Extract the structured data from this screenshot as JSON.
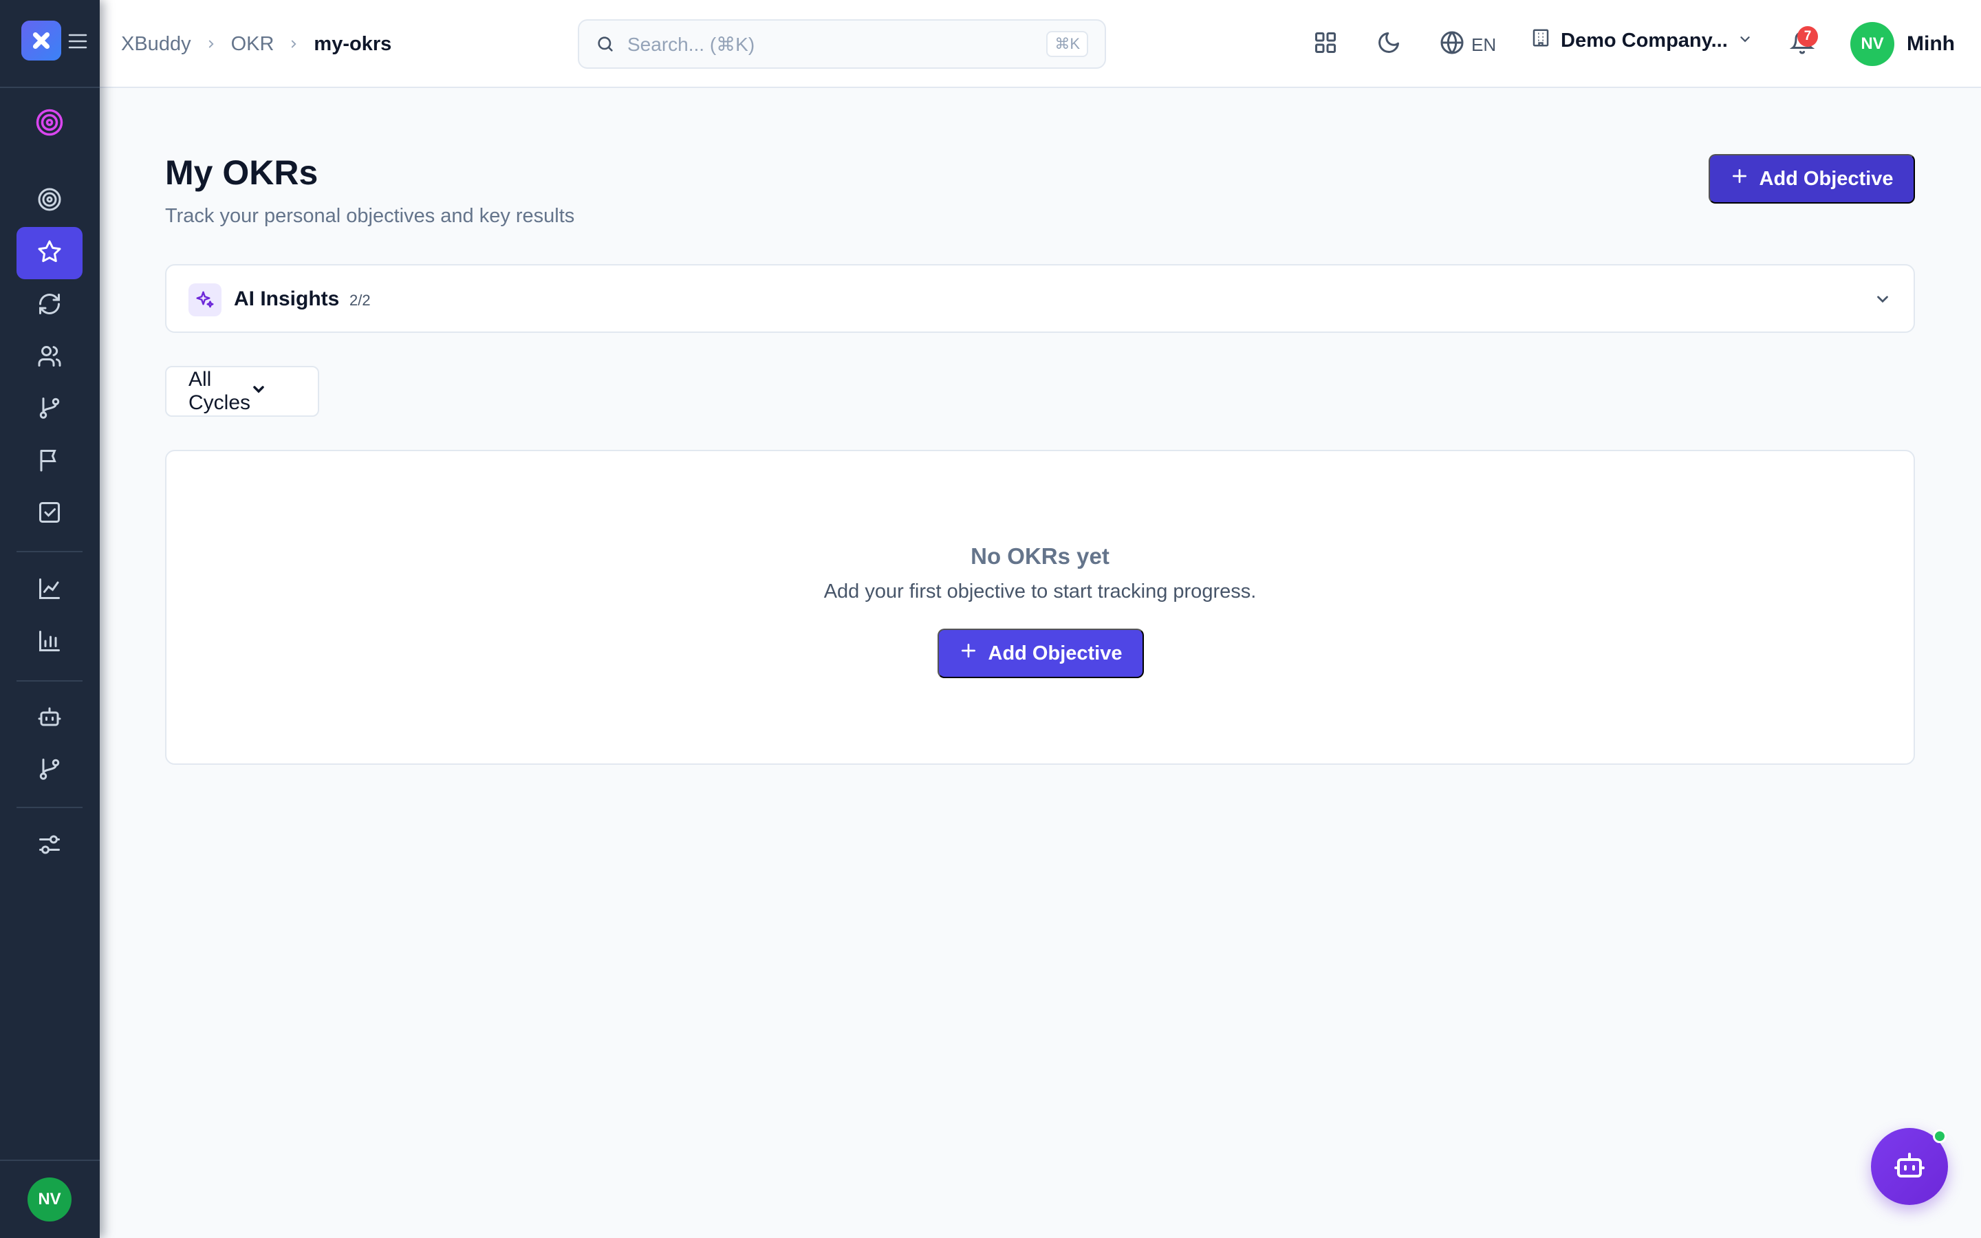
{
  "sidebar": {
    "logo_icon": "app-logo-icon",
    "menu_icon": "hamburger-icon",
    "avatar_initials": "NV",
    "items": [
      {
        "icon": "target-icon",
        "name": "okr-overview"
      },
      {
        "icon": "star-icon",
        "name": "my-okrs",
        "active": true
      },
      {
        "icon": "refresh-icon",
        "name": "check-ins"
      },
      {
        "icon": "users-icon",
        "name": "team"
      },
      {
        "icon": "branch-icon",
        "name": "alignment"
      },
      {
        "icon": "flag-icon",
        "name": "milestones"
      },
      {
        "icon": "checkbox-icon",
        "name": "tasks"
      },
      {
        "icon": "line-chart-icon",
        "name": "analytics"
      },
      {
        "icon": "bar-chart-icon",
        "name": "reports"
      },
      {
        "icon": "robot-icon",
        "name": "ai-assistant"
      },
      {
        "icon": "branch-icon",
        "name": "workflows"
      },
      {
        "icon": "sliders-icon",
        "name": "settings"
      }
    ]
  },
  "header": {
    "breadcrumbs": [
      "XBuddy",
      "OKR",
      "my-okrs"
    ],
    "search_placeholder": "Search... (⌘K)",
    "search_shortcut": "⌘K",
    "language": "EN",
    "company": "Demo Company...",
    "notification_count": "7",
    "user_initials": "NV",
    "user_name": "Minh"
  },
  "main": {
    "title": "My OKRs",
    "subtitle": "Track your personal objectives and key results",
    "add_button_label": "Add Objective",
    "insights": {
      "label": "AI Insights",
      "count": "2/2"
    },
    "cycle_filter": {
      "selected": "All Cycles"
    },
    "empty_state": {
      "title": "No OKRs yet",
      "description": "Add your first objective to start tracking progress.",
      "button_label": "Add Objective"
    }
  },
  "colors": {
    "sidebar_bg": "#1e293b",
    "primary": "#4338ca",
    "accent": "#4f46e5",
    "badge": "#ef4444",
    "avatar": "#22c55e"
  }
}
